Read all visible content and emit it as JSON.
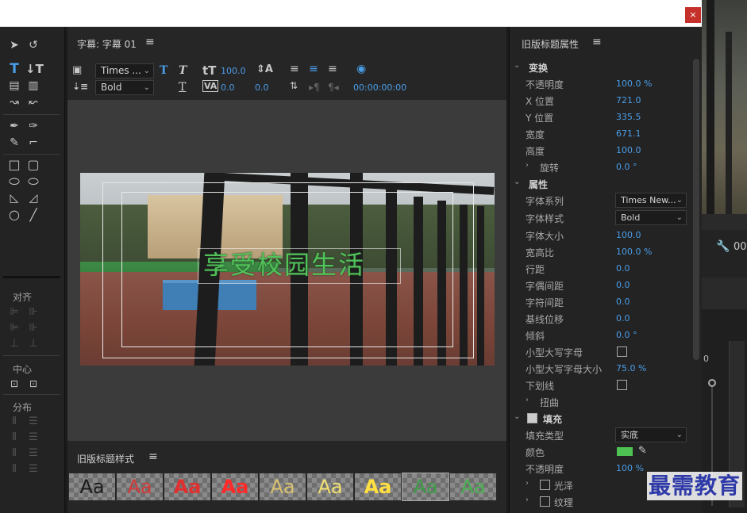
{
  "window": {
    "close_label": "×"
  },
  "editor": {
    "title": "字幕: 字幕 01",
    "menu_icon": "≡",
    "font_family": "Times ...",
    "font_style": "Bold",
    "font_size": "100.0",
    "kerning": "0.0",
    "tracking": "0.0",
    "timecode": "00:00:00:00",
    "caption_text": "享受校园生活"
  },
  "styles_panel": {
    "title": "旧版标题样式",
    "menu_icon": "≡",
    "swatches": [
      {
        "label": "Aa",
        "color": "#1a1a1a"
      },
      {
        "label": "Aa",
        "color": "#d23a3a"
      },
      {
        "label": "Aa",
        "color": "#e03030"
      },
      {
        "label": "Aa",
        "color": "#ff2a2a"
      },
      {
        "label": "Aa",
        "color": "#d8c070"
      },
      {
        "label": "Aa",
        "color": "#f0e070"
      },
      {
        "label": "Aa",
        "color": "#ffe040"
      },
      {
        "label": "Aa",
        "color": "#3f9a48"
      },
      {
        "label": "Aa",
        "color": "#49b052"
      }
    ]
  },
  "tools_panel": {
    "align_label": "对齐",
    "center_label": "中心",
    "distribute_label": "分布"
  },
  "properties": {
    "title": "旧版标题属性",
    "menu_icon": "≡",
    "transform_section": "变换",
    "opacity_label": "不透明度",
    "opacity_value": "100.0 %",
    "x_label": "X 位置",
    "x_value": "721.0",
    "y_label": "Y 位置",
    "y_value": "335.5",
    "width_label": "宽度",
    "width_value": "671.1",
    "height_label": "高度",
    "height_value": "100.0",
    "rotation_label": "旋转",
    "rotation_value": "0.0 °",
    "attributes_section": "属性",
    "font_family_label": "字体系列",
    "font_family_value": "Times New...",
    "font_style_label": "字体样式",
    "font_style_value": "Bold",
    "font_size_label": "字体大小",
    "font_size_value": "100.0",
    "aspect_label": "宽高比",
    "aspect_value": "100.0 %",
    "leading_label": "行距",
    "leading_value": "0.0",
    "kerning_label": "字偶间距",
    "kerning_value": "0.0",
    "tracking_label": "字符间距",
    "tracking_value": "0.0",
    "baseline_label": "基线位移",
    "baseline_value": "0.0",
    "slant_label": "倾斜",
    "slant_value": "0.0 °",
    "small_caps_label": "小型大写字母",
    "small_caps_size_label": "小型大写字母大小",
    "small_caps_size_value": "75.0 %",
    "underline_label": "下划线",
    "distort_label": "扭曲",
    "fill_section": "填充",
    "fill_type_label": "填充类型",
    "fill_type_value": "实底",
    "color_label": "颜色",
    "fill_color": "#4fc254",
    "fill_opacity_label": "不透明度",
    "fill_opacity_value": "100 %",
    "sheen_label": "光泽",
    "texture_label": "纹理"
  },
  "background": {
    "right_number": "00",
    "zero_label": "0"
  },
  "watermark": "最需教育"
}
